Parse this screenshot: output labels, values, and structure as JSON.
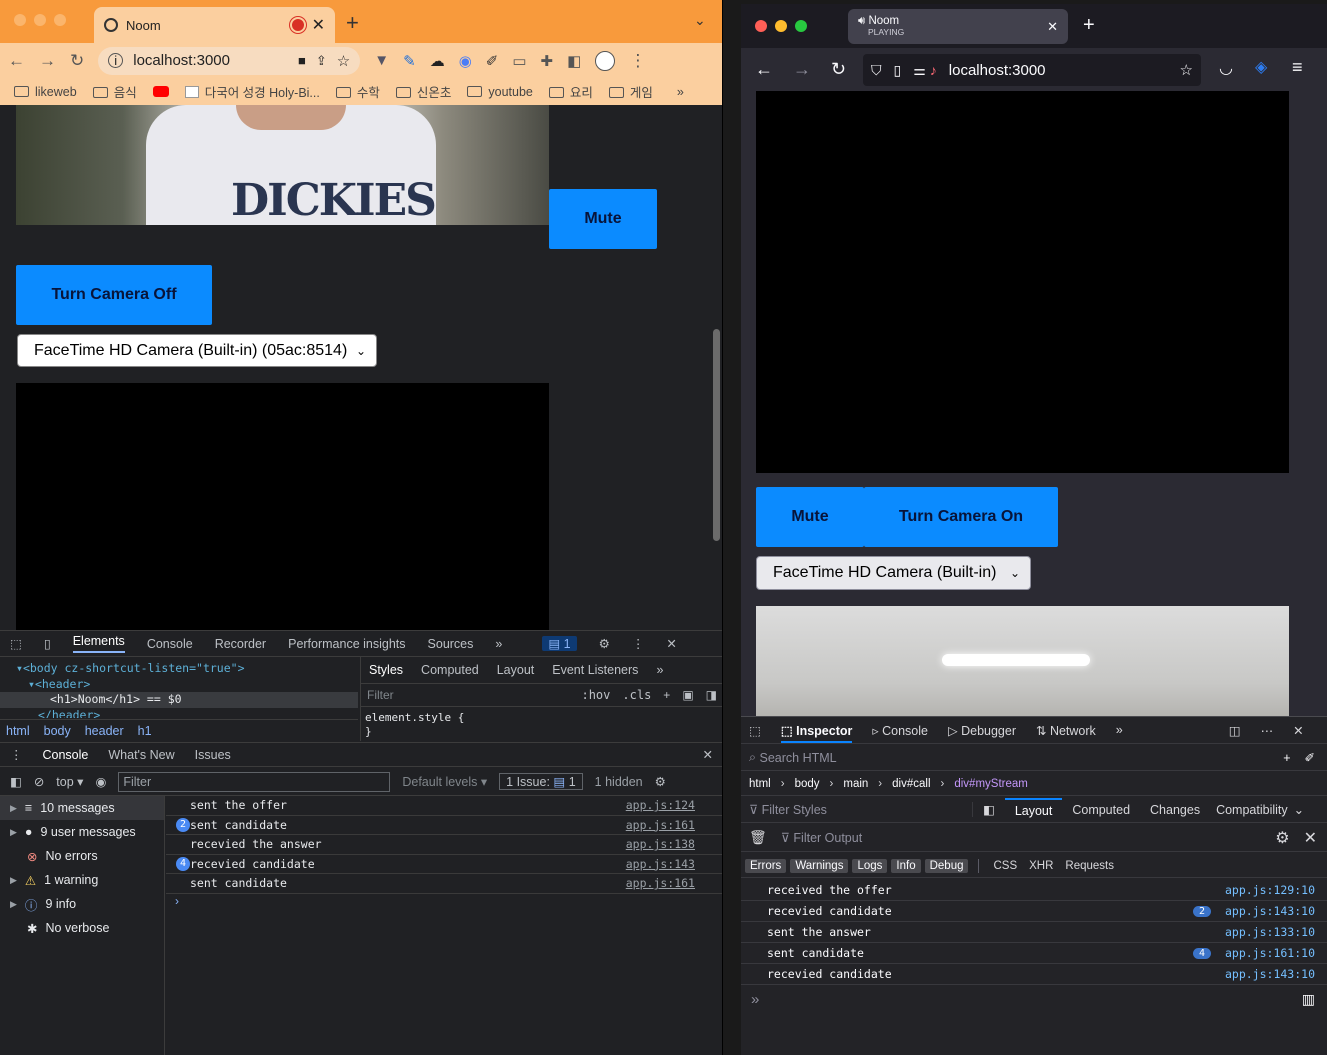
{
  "left_browser": {
    "tab_title": "Noom",
    "url": "localhost:3000",
    "bookmarks": [
      "likeweb",
      "음식",
      "다국어 성경 Holy-Bi...",
      "수학",
      "신온초",
      "youtube",
      "요리",
      "게임"
    ],
    "page": {
      "mute_label": "Mute",
      "camera_label": "Turn Camera Off",
      "camera_select": "FaceTime HD Camera (Built-in) (05ac:8514)",
      "shirt_text": "DICKIES"
    },
    "devtools": {
      "tabs": [
        "Elements",
        "Console",
        "Recorder",
        "Performance insights",
        "Sources"
      ],
      "issue_count": "1",
      "dom_lines": [
        "<body cz-shortcut-listen=\"true\">",
        "<header>",
        "<h1>Noom</h1> == $0",
        "</header>"
      ],
      "breadcrumb": [
        "html",
        "body",
        "header",
        "h1"
      ],
      "style_tabs": [
        "Styles",
        "Computed",
        "Layout",
        "Event Listeners"
      ],
      "filter_placeholder": "Filter",
      "hov": ":hov",
      "cls": ".cls",
      "element_style": "element.style {",
      "close_brace": "}",
      "drawer_tabs": [
        "Console",
        "What's New",
        "Issues"
      ],
      "context": "top",
      "console_filter": "Filter",
      "default_levels": "Default levels",
      "issue_label": "1 Issue:",
      "hidden": "1 hidden",
      "sidebar": [
        "10 messages",
        "9 user messages",
        "No errors",
        "1 warning",
        "9 info",
        "No verbose"
      ],
      "messages": [
        {
          "text": "sent the offer",
          "src": "app.js:124",
          "count": ""
        },
        {
          "text": "sent candidate",
          "src": "app.js:161",
          "count": "2"
        },
        {
          "text": "recevied the answer",
          "src": "app.js:138",
          "count": ""
        },
        {
          "text": "recevied candidate",
          "src": "app.js:143",
          "count": "4"
        },
        {
          "text": "sent candidate",
          "src": "app.js:161",
          "count": ""
        }
      ]
    }
  },
  "right_browser": {
    "tab_title": "Noom",
    "tab_sub": "PLAYING",
    "url": "localhost:3000",
    "page": {
      "mute_label": "Mute",
      "camera_label": "Turn Camera On",
      "camera_select": "FaceTime HD Camera (Built-in)"
    },
    "devtools": {
      "tabs": [
        "Inspector",
        "Console",
        "Debugger",
        "Network"
      ],
      "search_placeholder": "Search HTML",
      "breadcrumb": [
        "html",
        "body",
        "main",
        "div#call",
        "div#myStream"
      ],
      "filter_styles": "Filter Styles",
      "layout_tabs": [
        "Layout",
        "Computed",
        "Changes",
        "Compatibility"
      ],
      "filter_output": "Filter Output",
      "levels": [
        "Errors",
        "Warnings",
        "Logs",
        "Info",
        "Debug"
      ],
      "types": [
        "CSS",
        "XHR",
        "Requests"
      ],
      "messages": [
        {
          "text": "received the offer",
          "src": "app.js:129:10",
          "count": ""
        },
        {
          "text": "recevied candidate",
          "src": "app.js:143:10",
          "count": "2"
        },
        {
          "text": "sent the answer",
          "src": "app.js:133:10",
          "count": ""
        },
        {
          "text": "sent candidate",
          "src": "app.js:161:10",
          "count": "4"
        },
        {
          "text": "recevied candidate",
          "src": "app.js:143:10",
          "count": ""
        }
      ]
    }
  }
}
